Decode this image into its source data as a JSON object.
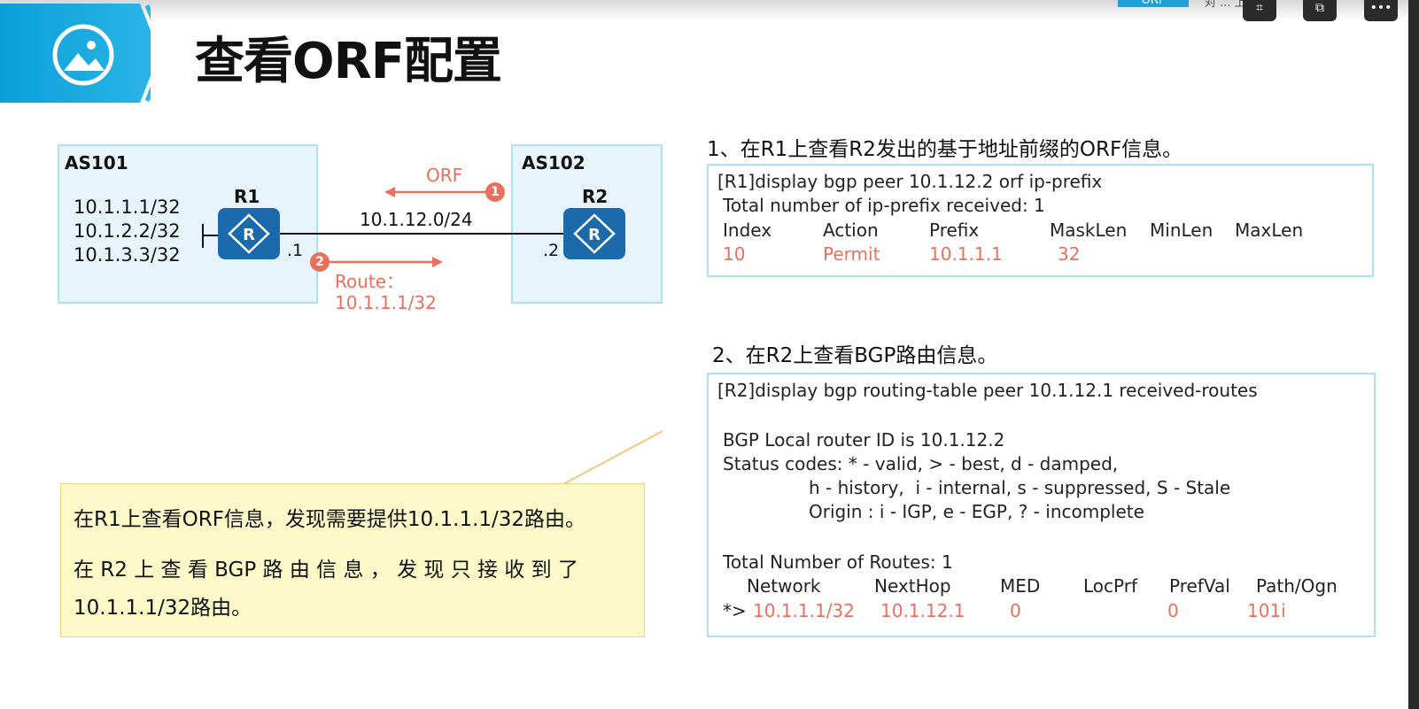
{
  "slide": {
    "title": "查看ORF配置"
  },
  "toolbar": {
    "tab_label": "ORF",
    "crumbs": "对 ... 上 传",
    "buttons": [
      "screenshot-icon",
      "clip-icon",
      "more-icon"
    ]
  },
  "topology": {
    "as_left": "AS101",
    "as_right": "AS102",
    "prefixes": [
      "10.1.1.1/32",
      "10.1.2.2/32",
      "10.1.3.3/32"
    ],
    "r1": {
      "name": "R1",
      "if_suffix": ".1"
    },
    "r2": {
      "name": "R2",
      "if_suffix": ".2"
    },
    "link_network": "10.1.12.0/24",
    "orf_label": "ORF",
    "route_label": "Route：",
    "route_value": "10.1.1.1/32",
    "badge1": "1",
    "badge2": "2"
  },
  "step1": {
    "title": "1、在R1上查看R2发出的基于地址前缀的ORF信息。",
    "command": "[R1]display bgp peer 10.1.12.2 orf ip-prefix",
    "total": "Total number of ip-prefix received: 1",
    "headers": [
      "Index",
      "Action",
      "Prefix",
      "MaskLen",
      "MinLen",
      "MaxLen"
    ],
    "row": [
      "10",
      "Permit",
      "10.1.1.1",
      "32"
    ]
  },
  "step2": {
    "title": "2、在R2上查看BGP路由信息。",
    "command": "[R2]display bgp routing-table peer 10.1.12.1 received-routes",
    "router_id": "BGP Local router ID is 10.1.12.2",
    "status1": "Status codes: * - valid, > - best, d - damped,",
    "status2": "h - history,  i - internal, s - suppressed, S - Stale",
    "origin": "Origin : i - IGP, e - EGP, ? - incomplete",
    "total": "Total Number of Routes: 1",
    "headers": [
      "Network",
      "NextHop",
      "MED",
      "LocPrf",
      "PrefVal",
      "Path/Ogn"
    ],
    "row_prefix": "*>",
    "row": [
      "10.1.1.1/32",
      "10.1.12.1",
      "0",
      "0",
      "101i"
    ]
  },
  "note": {
    "line1": "在R1上查看ORF信息，发现需要提供10.1.1.1/32路由。",
    "line2": "在 R2 上 查 看 BGP 路 由 信 息 ， 发 现 只 接 收 到 了",
    "line3": "10.1.1.1/32路由。"
  },
  "colors": {
    "accent": "#1fa1d6",
    "highlight": "#e8705e",
    "box_border": "#aee0f4",
    "note_bg": "#fdf9c8"
  }
}
